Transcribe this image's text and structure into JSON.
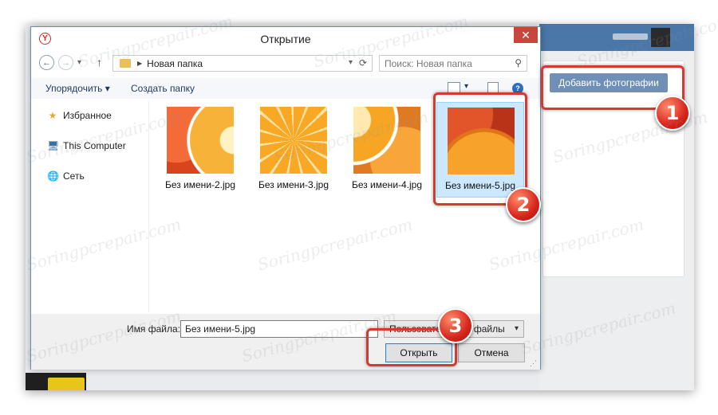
{
  "dialog": {
    "title": "Открытие",
    "app_icon_letter": "Y",
    "close_glyph": "✕",
    "nav": {
      "back_glyph": "←",
      "forward_glyph": "→",
      "recent_glyph": "▾",
      "up_glyph": "↑",
      "path": "Новая папка",
      "search_placeholder": "Поиск: Новая папка"
    },
    "toolbar": {
      "organize_label": "Упорядочить ▾",
      "new_folder_label": "Создать папку",
      "help_glyph": "?"
    },
    "sidebar": [
      {
        "label": "Избранное",
        "icon": "star-icon",
        "glyph": "★"
      },
      {
        "label": "This Computer",
        "icon": "computer-icon",
        "glyph": "🖥"
      },
      {
        "label": "Сеть",
        "icon": "network-icon",
        "glyph": "🌐"
      }
    ],
    "files": [
      {
        "name": "Без имени-2.jpg",
        "selected": false
      },
      {
        "name": "Без имени-3.jpg",
        "selected": false
      },
      {
        "name": "Без имени-4.jpg",
        "selected": false
      },
      {
        "name": "Без имени-5.jpg",
        "selected": true
      }
    ],
    "bottom": {
      "filename_label": "Имя файла:",
      "filename_value": "Без имени-5.jpg",
      "filter_value": "Пользовательские файлы",
      "open_label": "Открыть",
      "cancel_label": "Отмена"
    }
  },
  "vk": {
    "add_photos_label": "Добавить фотографии"
  },
  "annotations": [
    {
      "number": "1"
    },
    {
      "number": "2"
    },
    {
      "number": "3"
    }
  ],
  "watermark": "Soringpcrepair.com",
  "colors": {
    "accent": "#6f8fb6",
    "highlight": "#d33b32",
    "selection": "#cce8ff",
    "close": "#c7463e"
  }
}
